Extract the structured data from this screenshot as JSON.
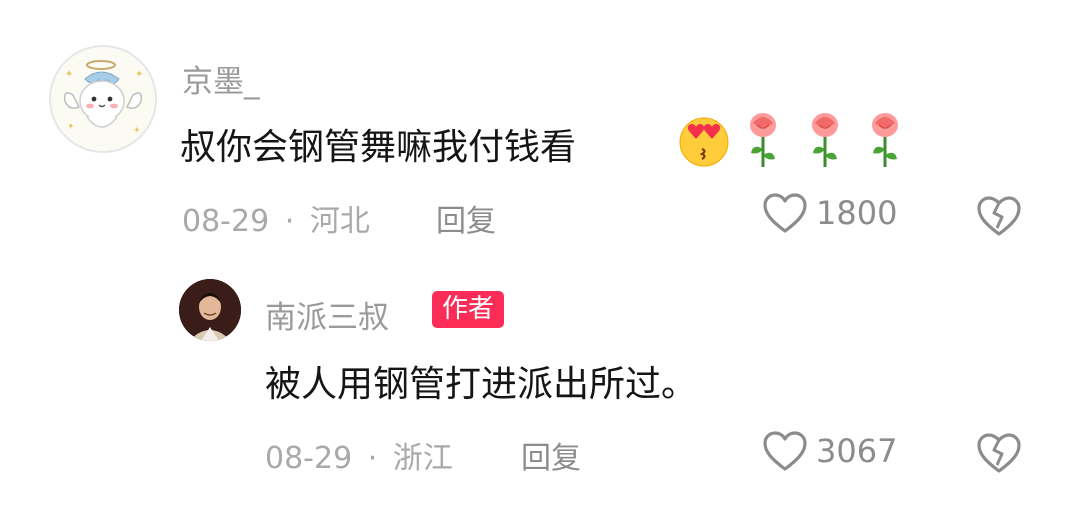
{
  "comments": [
    {
      "username": "京墨_",
      "text": "叔你会钢管舞嘛我付钱看",
      "emojis": [
        "heart-eyes-kiss-emoji",
        "rose-emoji",
        "rose-emoji",
        "rose-emoji"
      ],
      "date": "08-29",
      "separator": "·",
      "location": "河北",
      "reply_label": "回复",
      "like_count": "1800"
    }
  ],
  "reply": {
    "username": "南派三叔",
    "badge": "作者",
    "text": "被人用钢管打进派出所过。",
    "date": "08-29",
    "separator": "·",
    "location": "浙江",
    "reply_label": "回复",
    "like_count": "3067"
  },
  "colors": {
    "badge_bg": "#fb2c55",
    "meta_text": "#a9a9a9",
    "content_text": "#151515"
  }
}
